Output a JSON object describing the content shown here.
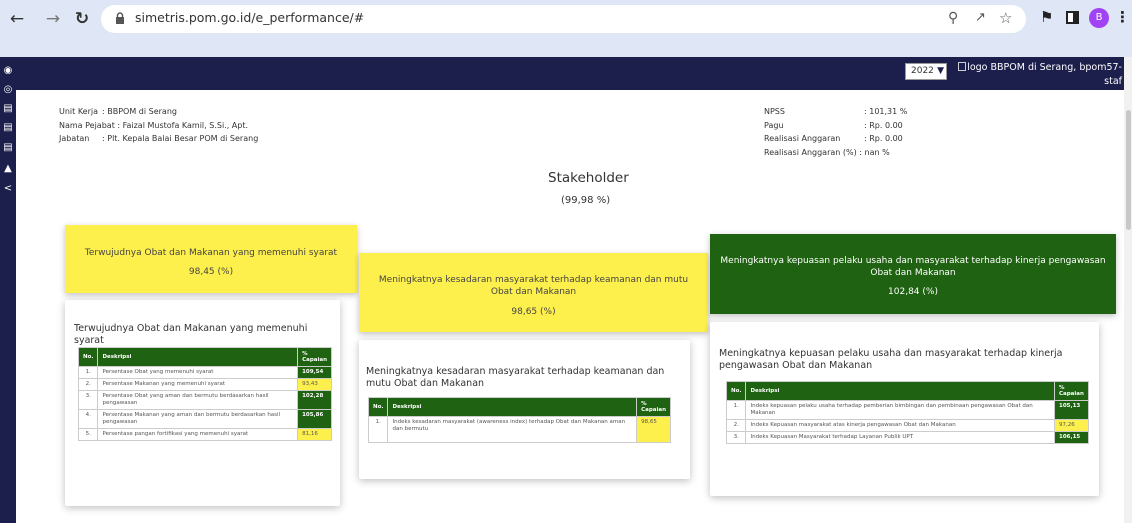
{
  "browser": {
    "url": "simetris.pom.go.id/e_performance/#",
    "profile_initial": "B",
    "icons": [
      "back-icon",
      "forward-icon",
      "reload-icon",
      "lock-icon",
      "zoom-icon",
      "share-icon",
      "star-icon",
      "extensions-icon",
      "side-panel-icon",
      "menu-icon"
    ]
  },
  "header": {
    "year": "2022",
    "logo_alt": "logo BBPOM di Serang, bpom57-staf"
  },
  "profile": {
    "unit_label": "Unit Kerja",
    "unit_value": ": BBPOM di Serang",
    "name_label": "Nama Pejabat",
    "name_value": ": Faizal Mustofa Kamil, S.Si., Apt.",
    "title_label": "Jabatan",
    "title_value": ": Plt. Kepala Balai Besar POM di Serang"
  },
  "summary": {
    "npss_label": "NPSS",
    "npss_value": ": 101,31 %",
    "pagu_label": "Pagu",
    "pagu_value": ": Rp. 0.00",
    "real_label": "Realisasi Anggaran",
    "real_value": ": Rp. 0.00",
    "realpct_label": "Realisasi Anggaran (%)",
    "realpct_value": ": nan %"
  },
  "stakeholder": {
    "title": "Stakeholder",
    "value": "(99,98 %)"
  },
  "targets": [
    {
      "title": "Terwujudnya Obat dan Makanan yang memenuhi syarat",
      "value": "98,45 (%)",
      "color": "#fef04c",
      "card_title": "Terwujudnya Obat dan Makanan yang memenuhi syarat",
      "col_no": "No.",
      "col_desc": "Deskripsi",
      "col_pct_a": "%",
      "col_pct_b": "Capaian",
      "rows": [
        {
          "no": "1.",
          "desc": "Persentase Obat yang memenuhi syarat",
          "val": "109,54",
          "status": "green"
        },
        {
          "no": "2.",
          "desc": "Persentase Makanan yang memenuhi syarat",
          "val": "93,43",
          "status": "yellow"
        },
        {
          "no": "3.",
          "desc": "Persentase Obat yang aman dan bermutu berdasarkan hasil pengawasan",
          "val": "102,28",
          "status": "green"
        },
        {
          "no": "4.",
          "desc": "Persentase Makanan yang aman dan bermutu berdasarkan hasil pengawasan",
          "val": "105,86",
          "status": "green"
        },
        {
          "no": "5.",
          "desc": "Persentase pangan fortifikasi yang memenuhi syarat",
          "val": "81,16",
          "status": "yellow"
        }
      ]
    },
    {
      "title": "Meningkatnya kesadaran masyarakat terhadap keamanan dan mutu Obat dan Makanan",
      "value": "98,65 (%)",
      "color": "#fef04c",
      "card_title": "Meningkatnya kesadaran masyarakat terhadap keamanan dan mutu Obat dan Makanan",
      "col_no": "No.",
      "col_desc": "Deskripsi",
      "col_pct_a": "%",
      "col_pct_b": "Capaian",
      "rows": [
        {
          "no": "1.",
          "desc": "Indeks kesadaran masyarakat (awareness index) terhadap Obat dan Makanan aman dan bermutu",
          "val": "98,65",
          "status": "yellow"
        }
      ]
    },
    {
      "title": "Meningkatnya kepuasan pelaku usaha dan masyarakat terhadap kinerja pengawasan Obat dan Makanan",
      "value": "102,84 (%)",
      "color": "#1e6212",
      "card_title": "Meningkatnya kepuasan pelaku usaha dan masyarakat terhadap kinerja pengawasan Obat dan Makanan",
      "col_no": "No.",
      "col_desc": "Deskripsi",
      "col_pct_a": "%",
      "col_pct_b": "Capaian",
      "rows": [
        {
          "no": "1.",
          "desc": "Indeks kepuasan pelaku usaha terhadap pemberian bimbingan dan pembinaan pengawasan Obat dan Makanan",
          "val": "105,13",
          "status": "green"
        },
        {
          "no": "2.",
          "desc": "Indeks Kepuasan masyarakat atas kinerja pengawasan Obat dan Makanan",
          "val": "97,26",
          "status": "yellow"
        },
        {
          "no": "3.",
          "desc": "Indeks Kepuasan Masyarakat terhadap Layanan Publik UPT",
          "val": "106,15",
          "status": "green"
        }
      ]
    }
  ],
  "colors": {
    "navy": "#1c1f4c",
    "green": "#1e6212",
    "yellow": "#fef04c"
  },
  "sidebar_icons": [
    "dashboard-icon",
    "target-icon",
    "database-icon",
    "database-icon",
    "database-icon",
    "sitemap-icon",
    "share-icon"
  ]
}
